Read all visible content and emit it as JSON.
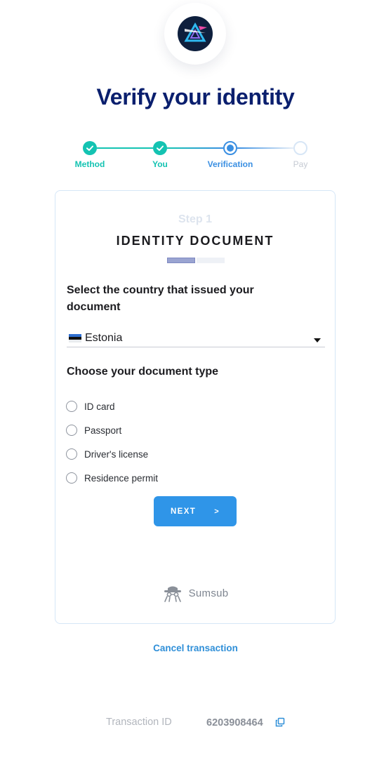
{
  "page": {
    "title": "Verify your identity"
  },
  "stepper": {
    "steps": [
      {
        "label": "Method",
        "state": "done"
      },
      {
        "label": "You",
        "state": "done"
      },
      {
        "label": "Verification",
        "state": "current"
      },
      {
        "label": "Pay",
        "state": "todo"
      }
    ],
    "colors": {
      "done": "#14c3b2",
      "current": "#3a8fe2",
      "todo": "#c5cad3"
    }
  },
  "card": {
    "step_label": "Step 1",
    "heading": "IDENTITY DOCUMENT",
    "progress": {
      "current": 1,
      "total": 2
    },
    "country_question": "Select the country that issued your document",
    "country_select": {
      "value": "Estonia",
      "flag": "estonia-flag-icon"
    },
    "doc_type_question": "Choose your document type",
    "doc_types": [
      "ID card",
      "Passport",
      "Driver's license",
      "Residence permit"
    ],
    "next_label": "NEXT",
    "next_arrow": ">",
    "powered_by": "Sumsub"
  },
  "footer": {
    "cancel_label": "Cancel transaction",
    "transaction_label": "Transaction ID",
    "transaction_id": "6203908464"
  },
  "colors": {
    "title": "#0a1f6e",
    "accent": "#2f95e8",
    "teal": "#14c3b2",
    "card_border": "#d5e6f7"
  }
}
